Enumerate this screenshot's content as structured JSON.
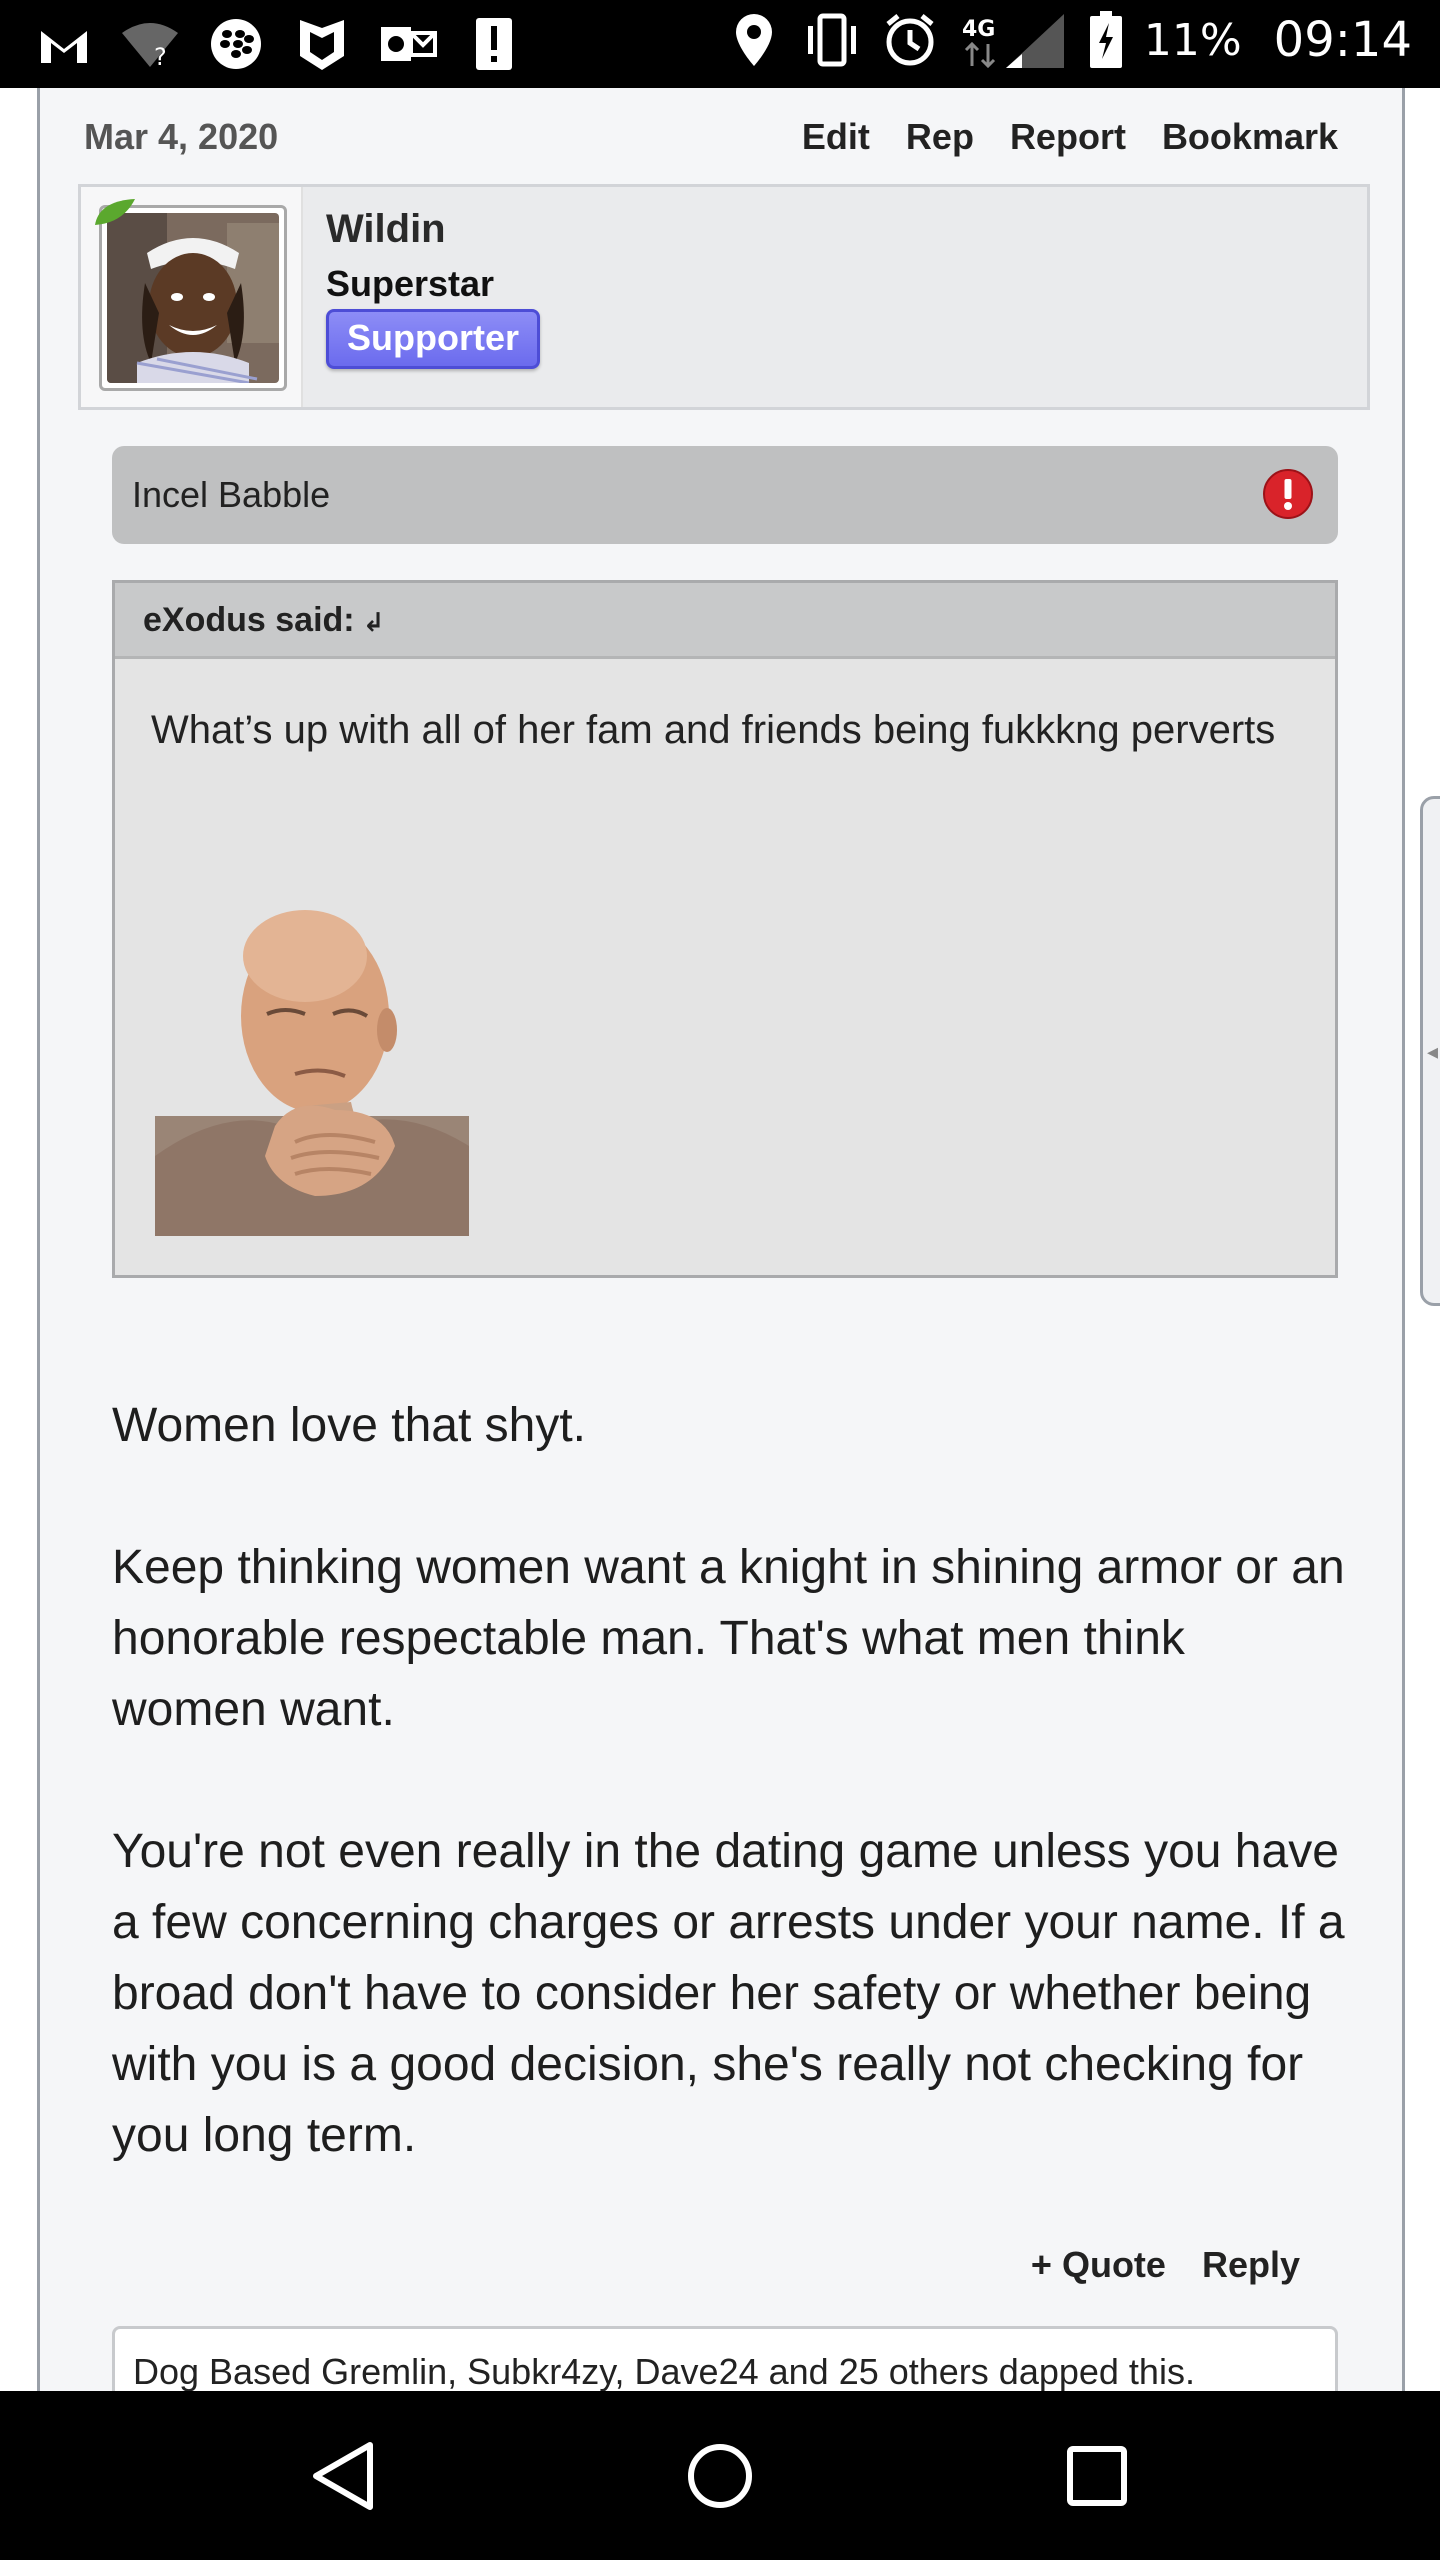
{
  "status_bar": {
    "left_icons": [
      "gmail-icon",
      "wifi-unknown-icon",
      "blackberry-icon",
      "shield-icon",
      "outlook-icon",
      "alert-icon"
    ],
    "right_icons": [
      "location-icon",
      "vibrate-icon",
      "alarm-icon",
      "4g-signal-icon",
      "battery-charging-icon"
    ],
    "network": "4G",
    "battery": "11%",
    "time": "09:14"
  },
  "post": {
    "date": "Mar 4, 2020",
    "actions": [
      "Edit",
      "Rep",
      "Report",
      "Bookmark"
    ],
    "author": {
      "name": "Wildin",
      "title": "Superstar",
      "badge": "Supporter"
    },
    "spoiler": {
      "label": "Incel Babble",
      "icon": "warning-icon"
    },
    "quote": {
      "author_label": "eXodus said:",
      "arrow": "↲",
      "text": "What’s up with all of her fam and friends being fukkkng perverts",
      "image": "facepalm-reaction-image"
    },
    "message": [
      "Women love that shyt.",
      "Keep thinking women want a knight in shining armor or an honorable respectable man. That's what men think women want.",
      "You're not even really in the dating game unless you have a few concerning charges or arrests under your name. If a broad don't have to consider her safety or whether being with you is a good decision, she's really not checking for you long term."
    ],
    "footer_actions": [
      "+ Quote",
      "Reply"
    ],
    "likes_text": "Dog Based Gremlin, Subkr4zy, Dave24 and 25 others dapped this."
  },
  "nav_bar": {
    "buttons": [
      "back-icon",
      "home-icon",
      "recents-icon"
    ]
  },
  "colors": {
    "supporter_badge": "#7a7af2",
    "spoiler_bg": "#bfc0c1",
    "quote_bg": "#e4e4e4",
    "page_bg": "#f5f6f8"
  }
}
